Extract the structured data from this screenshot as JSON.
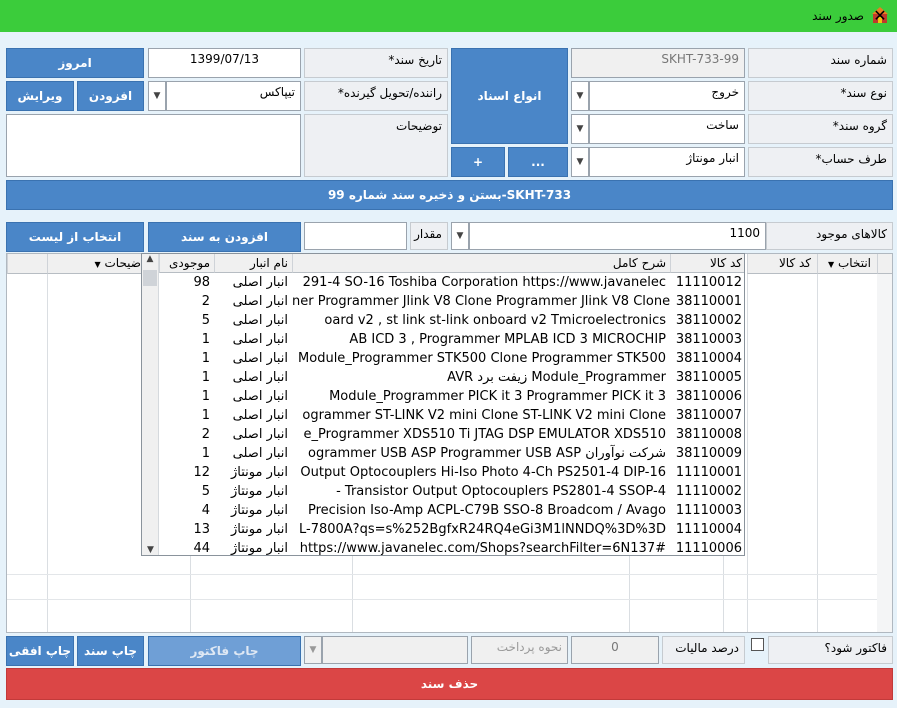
{
  "window": {
    "title": "صدور سند",
    "close": "✕"
  },
  "form": {
    "doc_number_label": "شماره سند",
    "doc_number_value": "99-SKHT-733",
    "doc_date_label": "تاریخ سند*",
    "doc_date_value": "1399/07/13",
    "today_btn": "امروز",
    "doc_type_label": "نوع سند*",
    "doc_type_value": "خروج",
    "doc_types_btn": "انواع اسناد",
    "driver_label": "راننده/تحویل گیرنده*",
    "driver_value": "تیپاکس",
    "add_btn": "افزودن",
    "edit_btn": "ویرایش",
    "doc_group_label": "گروه سند*",
    "doc_group_value": "ساخت",
    "desc_label": "توضیحات",
    "desc_value": "",
    "account_label": "طرف حساب*",
    "account_value": "انبار مونتاژ",
    "more_btn": "...",
    "plus_btn": "+"
  },
  "close_save_bar": "بستن و ذخیره سند شماره  99-SKHT-733",
  "item_picker": {
    "available_label": "کالاهای موجود",
    "available_value": "1100",
    "qty_label": "مقدار",
    "qty_value": "",
    "add_to_doc_btn": "افزودن به سند",
    "select_from_list_btn": "انتخاب از لیست"
  },
  "grid": {
    "headers": [
      "انتخاب",
      "کد کالا",
      "ضیحات"
    ]
  },
  "popup": {
    "headers": {
      "code": "کد کالا",
      "desc": "شرح کامل",
      "store": "نام انبار",
      "stock": "موجودی"
    },
    "rows": [
      {
        "code": "11110012",
        "desc": "291-4 SO-16 Toshiba Corporation  https://www.javanelec",
        "store": "انبار اصلی",
        "stock": "98"
      },
      {
        "code": "38110001",
        "desc": "ner Programmer Jlink V8 Clone Programmer Jlink V8 Clone",
        "store": "انبار اصلی",
        "stock": "2"
      },
      {
        "code": "38110002",
        "desc": "oard v2    ,      st link st-link onboard v2  Tmicroelectronics",
        "store": "انبار اصلی",
        "stock": "5"
      },
      {
        "code": "38110003",
        "desc": "AB ICD 3    ,      Programmer MPLAB ICD 3  MICROCHIP",
        "store": "انبار اصلی",
        "stock": "1"
      },
      {
        "code": "38110004",
        "desc": "Module_Programmer STK500 Clone Programmer STK500",
        "store": "انبار اصلی",
        "stock": "1"
      },
      {
        "code": "38110005",
        "desc": "AVR زیفت برد Module_Programmer",
        "store": "انبار اصلی",
        "stock": "1"
      },
      {
        "code": "38110006",
        "desc": "Module_Programmer PICK it 3 Programmer PICK it 3",
        "store": "انبار اصلی",
        "stock": "1"
      },
      {
        "code": "38110007",
        "desc": "ogrammer ST-LINK V2 mini Clone ST-LINK V2 mini Clone",
        "store": "انبار اصلی",
        "stock": "1"
      },
      {
        "code": "38110008",
        "desc": "e_Programmer XDS510 Ti JTAG DSP EMULATOR XDS510",
        "store": "انبار اصلی",
        "stock": "2"
      },
      {
        "code": "38110009",
        "desc": "ogrammer USB ASP Programmer USB ASP  شرکت نوآوران",
        "store": "انبار اصلی",
        "stock": "1"
      },
      {
        "code": "11110001",
        "desc": "Output Optocouplers Hi-Iso Photo 4-Ch PS2501-4 DIP-16",
        "store": "انبار مونتاژ",
        "stock": "12"
      },
      {
        "code": "11110002",
        "desc": "-      Transistor Output Optocouplers PS2801-4 SSOP-4",
        "store": "انبار مونتاژ",
        "stock": "5"
      },
      {
        "code": "11110003",
        "desc": "Precision Iso-Amp ACPL-C79B SSO-8 Broadcom / Avago",
        "store": "انبار مونتاژ",
        "stock": "4"
      },
      {
        "code": "11110004",
        "desc": "L-7800A?qs=s%252BgfxR24RQ4eGi3M1lNNDQ%3D%3D",
        "store": "انبار مونتاژ",
        "stock": "13"
      },
      {
        "code": "11110006",
        "desc": "https://www.javanelec.com/Shops?searchFilter=6N137#",
        "store": "انبار مونتاژ",
        "stock": "44"
      }
    ]
  },
  "footer": {
    "invoice_q_label": "فاکتور شود؟",
    "tax_label": "درصد مالیات",
    "tax_value": "0",
    "payment_placeholder": "نحوه پرداخت",
    "print_invoice_btn": "چاپ فاکتور",
    "print_doc_btn": "چاپ سند",
    "print_landscape_btn": "چاپ افقی",
    "delete_btn": "حذف سند"
  },
  "colors": {
    "title_bar": "#3bcc3b",
    "button_blue": "#4a86c8",
    "delete_red": "#db4646",
    "background": "#e6f2fa"
  }
}
